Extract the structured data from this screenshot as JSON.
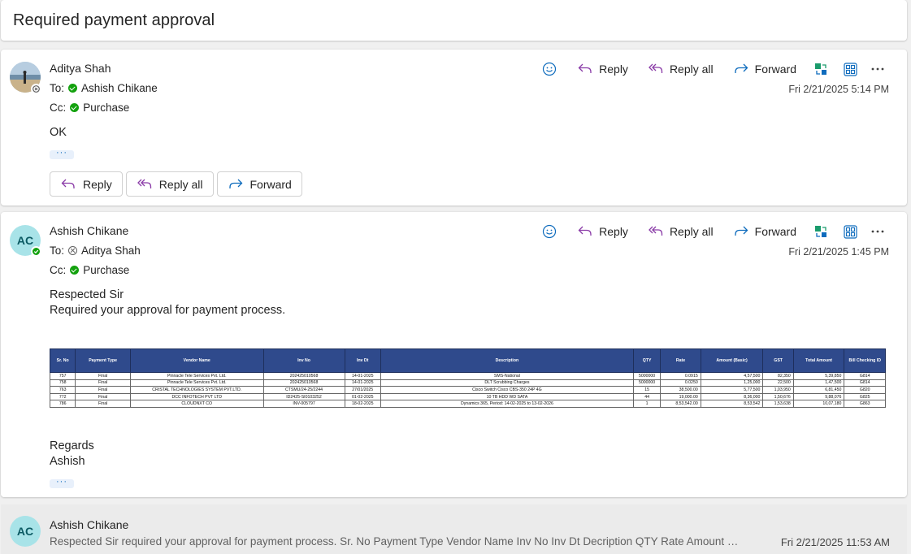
{
  "thread": {
    "subject": "Required payment approval"
  },
  "toolbar": {
    "reply": "Reply",
    "reply_all": "Reply all",
    "forward": "Forward"
  },
  "message1": {
    "sender": "Aditya Shah",
    "to_label": "To:",
    "to": "Ashish Chikane",
    "cc_label": "Cc:",
    "cc": "Purchase",
    "date": "Fri 2/21/2025 5:14 PM",
    "body": "OK",
    "ellipsis": "···",
    "buttons": {
      "reply": "Reply",
      "reply_all": "Reply all",
      "forward": "Forward"
    }
  },
  "message2": {
    "sender": "Ashish Chikane",
    "initials": "AC",
    "to_label": "To:",
    "to": "Aditya Shah",
    "cc_label": "Cc:",
    "cc": "Purchase",
    "date": "Fri 2/21/2025 1:45 PM",
    "greeting": "Respected Sir",
    "line1": "Required your approval for payment process.",
    "closing": "Regards",
    "signature": "Ashish",
    "ellipsis": "···",
    "table": {
      "headers": [
        "Sr. No",
        "Payment Type",
        "Vendor Name",
        "Inv No",
        "Inv Dt",
        "Description",
        "QTY",
        "Rate",
        "Amount (Basic)",
        "GST",
        "Total Amount",
        "Bill Checking ID"
      ],
      "rows": [
        [
          "757",
          "Final",
          "Pinnacle Tele Services Pvt. Ltd.",
          "202425010568",
          "14-01-2025",
          "SMS-National",
          "5000000",
          "0.0915",
          "4,57,500",
          "82,350",
          "5,39,850",
          "G814"
        ],
        [
          "758",
          "Final",
          "Pinnacle Tele Services Pvt. Ltd.",
          "202425010568",
          "14-01-2025",
          "DLT Scrubbing Charges",
          "5000000",
          "0.0250",
          "1,25,000",
          "22,500",
          "1,47,500",
          "G814"
        ],
        [
          "763",
          "Final",
          "CRISTAL TECHNOLOGIES SYSTEM PVT.LTD.",
          "CTSMU/24-25/2244",
          "27/01/2025",
          "Cisco Switch Cisco CBS-350 24P 4G",
          "15",
          "38,500.00",
          "5,77,500",
          "1,03,950",
          "6,81,450",
          "G820"
        ],
        [
          "772",
          "Final",
          "DCC INFOTECH PVT LTD",
          "ID2425-SI0103252",
          "01-02-2025",
          "10 TB HDD WD SATA",
          "44",
          "19,000.00",
          "8,36,000",
          "1,50,676",
          "9,88,076",
          "G825"
        ],
        [
          "786",
          "Final",
          "CLOUDNXT CO",
          "INV-005797",
          "18-02-2025",
          "Dynamics 365, Period: 14-02-2025 to 13-02-2026",
          "1",
          "8,53,542.00",
          "8,53,542",
          "1,53,638",
          "10,07,180",
          "G863"
        ]
      ]
    }
  },
  "message3": {
    "sender": "Ashish Chikane",
    "initials": "AC",
    "preview": "Respected Sir required your approval for payment process. Sr. No Payment Type Vendor Name Inv No Inv Dt Decription QTY Rate Amount (Basi...",
    "date": "Fri 2/21/2025 11:53 AM"
  },
  "icons": [
    "emoji-icon",
    "reply-icon",
    "reply-all-icon",
    "forward-icon",
    "teams-share-icon",
    "immersive-reader-icon",
    "more-icon"
  ],
  "colors": {
    "accent_purple": "#8a3ba7",
    "accent_blue": "#0f6cbd",
    "table_header": "#2f4a8c",
    "presence_green": "#13a10e",
    "avatar_bg": "#a8e3e8"
  }
}
